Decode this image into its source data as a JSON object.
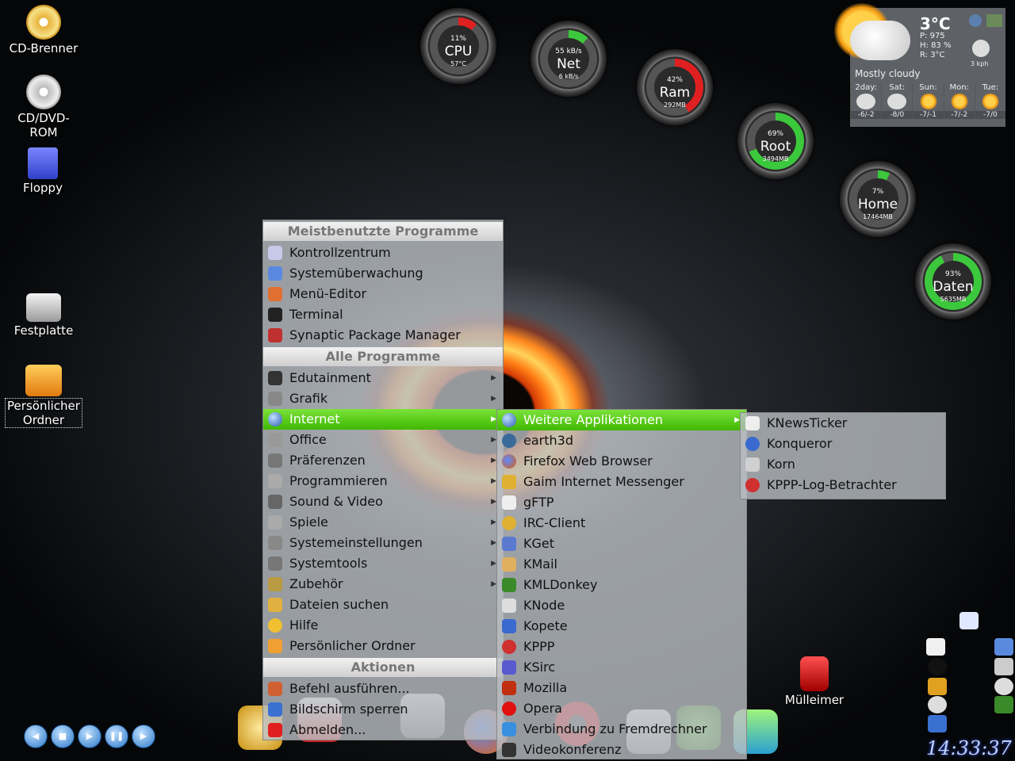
{
  "desktop": {
    "icons": [
      {
        "label": "CD-Brenner",
        "icon": "cd-burner-icon"
      },
      {
        "label": "CD/DVD-ROM",
        "icon": "cdrom-icon"
      },
      {
        "label": "Floppy",
        "icon": "floppy-icon"
      },
      {
        "label": "Festplatte",
        "icon": "harddisk-icon"
      },
      {
        "label": "Persönlicher Ordner",
        "icon": "home-folder-icon"
      },
      {
        "label": "Mülleimer",
        "icon": "trash-icon"
      }
    ]
  },
  "gauges": [
    {
      "name": "CPU",
      "pct": "11%",
      "sub": "57°C",
      "fill": 0.11,
      "color": "#e02020"
    },
    {
      "name": "Net",
      "pct": "55 kB/s",
      "sub": "6 kB/s",
      "fill": 0.12,
      "color": "#3cc83c"
    },
    {
      "name": "Ram",
      "pct": "42%",
      "sub": "292MB",
      "fill": 0.42,
      "color": "#e02020"
    },
    {
      "name": "Root",
      "pct": "69%",
      "sub": "3494MB",
      "fill": 0.69,
      "color": "#3cc83c"
    },
    {
      "name": "Home",
      "pct": "7%",
      "sub": "17464MB",
      "fill": 0.07,
      "color": "#3cc83c"
    },
    {
      "name": "Daten",
      "pct": "93%",
      "sub": "5635MB",
      "fill": 0.93,
      "color": "#3cc83c"
    }
  ],
  "weather": {
    "temp": "3°C",
    "pressure": "P: 975",
    "humidity": "H: 83 %",
    "realfeel": "R: 3°C",
    "wind": "3 kph",
    "condition": "Mostly cloudy",
    "forecast": [
      {
        "day": "2day:",
        "temps": "-6/-2",
        "icon": "cloudy-icon"
      },
      {
        "day": "Sat:",
        "temps": "-8/0",
        "icon": "cloudy-icon"
      },
      {
        "day": "Sun:",
        "temps": "-7/-1",
        "icon": "sunny-icon"
      },
      {
        "day": "Mon:",
        "temps": "-7/-2",
        "icon": "sunny-icon"
      },
      {
        "day": "Tue:",
        "temps": "-7/0",
        "icon": "sunny-icon"
      }
    ]
  },
  "main_menu": {
    "header_most_used": "Meistbenutzte Programme",
    "most_used": [
      "Kontrollzentrum",
      "Systemüberwachung",
      "Menü-Editor",
      "Terminal",
      "Synaptic Package Manager"
    ],
    "header_all": "Alle Programme",
    "all": [
      {
        "label": "Edutainment",
        "sub": true
      },
      {
        "label": "Grafik",
        "sub": true
      },
      {
        "label": "Internet",
        "sub": true,
        "active": true
      },
      {
        "label": "Office",
        "sub": true
      },
      {
        "label": "Präferenzen",
        "sub": true
      },
      {
        "label": "Programmieren",
        "sub": true
      },
      {
        "label": "Sound & Video",
        "sub": true
      },
      {
        "label": "Spiele",
        "sub": true
      },
      {
        "label": "Systemeinstellungen",
        "sub": true
      },
      {
        "label": "Systemtools",
        "sub": true
      },
      {
        "label": "Zubehör",
        "sub": true
      },
      {
        "label": "Dateien suchen",
        "sub": false
      },
      {
        "label": "Hilfe",
        "sub": false
      },
      {
        "label": "Persönlicher Ordner",
        "sub": false
      }
    ],
    "header_actions": "Aktionen",
    "actions": [
      "Befehl ausführen...",
      "Bildschirm sperren",
      "Abmelden..."
    ]
  },
  "internet_menu": {
    "items": [
      {
        "label": "Weitere Applikationen",
        "sub": true,
        "active": true
      },
      {
        "label": "earth3d"
      },
      {
        "label": "Firefox Web Browser"
      },
      {
        "label": "Gaim Internet Messenger"
      },
      {
        "label": "gFTP"
      },
      {
        "label": "IRC-Client"
      },
      {
        "label": "KGet"
      },
      {
        "label": "KMail"
      },
      {
        "label": "KMLDonkey"
      },
      {
        "label": "KNode"
      },
      {
        "label": "Kopete"
      },
      {
        "label": "KPPP"
      },
      {
        "label": "KSirc"
      },
      {
        "label": "Mozilla"
      },
      {
        "label": "Opera"
      },
      {
        "label": "Verbindung zu Fremdrechner"
      },
      {
        "label": "Videokonferenz"
      }
    ]
  },
  "more_apps_menu": {
    "items": [
      "KNewsTicker",
      "Konqueror",
      "Korn",
      "KPPP-Log-Betrachter"
    ]
  },
  "clock": "14:33:37",
  "colors": {
    "menu_highlight": "#4cc212",
    "gauge_green": "#3cc83c",
    "gauge_red": "#e02020"
  }
}
